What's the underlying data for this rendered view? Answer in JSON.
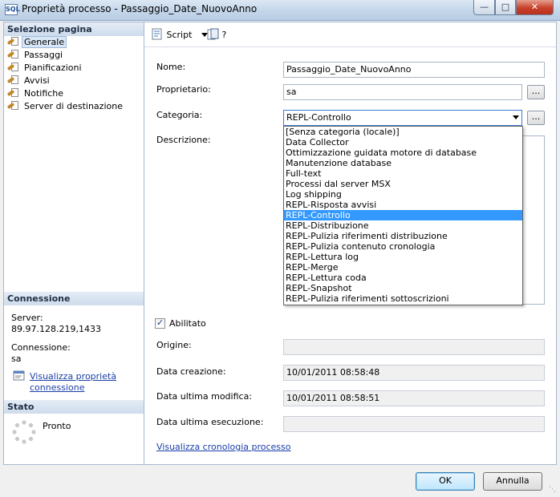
{
  "window": {
    "title": "Proprietà processo - Passaggio_Date_NuovoAnno",
    "icon": "job-icon",
    "icon_text": "SQL"
  },
  "left": {
    "select_page_header": "Selezione pagina",
    "nav_items": [
      {
        "label": "Generale",
        "selected": true
      },
      {
        "label": "Passaggi"
      },
      {
        "label": "Pianificazioni"
      },
      {
        "label": "Avvisi"
      },
      {
        "label": "Notifiche"
      },
      {
        "label": "Server di destinazione"
      }
    ],
    "connection_header": "Connessione",
    "server_label": "Server:",
    "server_value": "89.97.128.219,1433",
    "connection_label": "Connessione:",
    "connection_value": "sa",
    "view_conn_link_line1": "Visualizza proprietà",
    "view_conn_link_line2": "connessione",
    "status_header": "Stato",
    "status_value": "Pronto"
  },
  "toolbar": {
    "script_label": "Script",
    "help_label": "?"
  },
  "form": {
    "name_label": "Nome:",
    "name_value": "Passaggio_Date_NuovoAnno",
    "owner_label": "Proprietario:",
    "owner_value": "sa",
    "category_label": "Categoria:",
    "category_value": "REPL-Controllo",
    "description_label": "Descrizione:",
    "ellipsis": "...",
    "enabled_label": "Abilitato",
    "enabled_checked": true,
    "origin_label": "Origine:",
    "origin_value": "",
    "created_label": "Data creazione:",
    "created_value": "10/01/2011 08:58:48",
    "modified_label": "Data ultima modifica:",
    "modified_value": "10/01/2011 08:58:51",
    "last_exec_label": "Data ultima esecuzione:",
    "last_exec_value": "",
    "history_link": "Visualizza cronologia processo"
  },
  "category_options": [
    {
      "label": "[Senza categoria (locale)]"
    },
    {
      "label": "Data Collector"
    },
    {
      "label": "Ottimizzazione guidata motore di database"
    },
    {
      "label": "Manutenzione database"
    },
    {
      "label": "Full-text"
    },
    {
      "label": "Processi dal server MSX"
    },
    {
      "label": "Log shipping"
    },
    {
      "label": "REPL-Risposta avvisi"
    },
    {
      "label": "REPL-Controllo",
      "selected": true
    },
    {
      "label": "REPL-Distribuzione"
    },
    {
      "label": "REPL-Pulizia riferimenti distribuzione"
    },
    {
      "label": "REPL-Pulizia contenuto cronologia"
    },
    {
      "label": "REPL-Lettura log"
    },
    {
      "label": "REPL-Merge"
    },
    {
      "label": "REPL-Lettura coda"
    },
    {
      "label": "REPL-Snapshot"
    },
    {
      "label": "REPL-Pulizia riferimenti sottoscrizioni"
    }
  ],
  "buttons": {
    "ok": "OK",
    "cancel": "Annulla"
  },
  "colors": {
    "selection": "#3399ff",
    "link": "#1a3ea8"
  }
}
